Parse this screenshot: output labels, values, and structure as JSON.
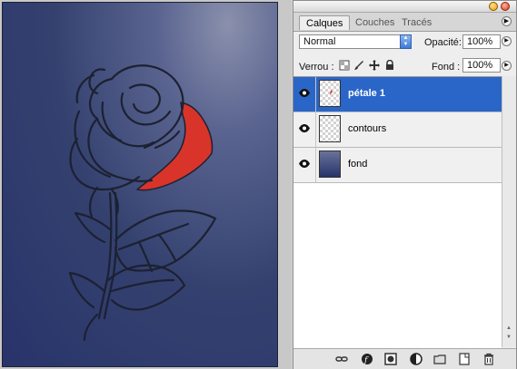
{
  "palette": {
    "tabs": [
      "Calques",
      "Couches",
      "Tracés"
    ],
    "active_tab": "Calques",
    "blend_mode": "Normal",
    "opacity_label": "Opacité:",
    "opacity_value": "100%",
    "lock_label": "Verrou :",
    "fill_label": "Fond :",
    "fill_value": "100%",
    "layers": [
      {
        "name": "pétale 1",
        "visible": true,
        "selected": true,
        "thumb": "transparent-red"
      },
      {
        "name": "contours",
        "visible": true,
        "selected": false,
        "thumb": "transparent"
      },
      {
        "name": "fond",
        "visible": true,
        "selected": false,
        "thumb": "blue-gradient"
      }
    ],
    "bottom_tools": [
      "link-icon",
      "layer-style-icon",
      "mask-icon",
      "adjustment-icon",
      "group-folder-icon",
      "new-layer-icon",
      "trash-icon"
    ]
  },
  "colors": {
    "canvas_bg": "#2e3a6c",
    "rose_outline": "#1c2132",
    "petal_fill": "#d9342a",
    "selection": "#2a66c8"
  }
}
